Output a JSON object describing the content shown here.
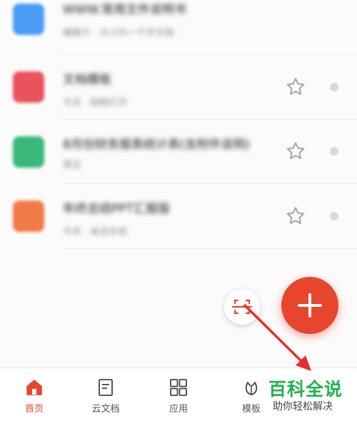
{
  "file_list": {
    "items": [
      {
        "title": "WWW.常用文件说明书",
        "subtitle": "编辑于 · 大小约一千字文档",
        "icon": "document-icon",
        "icon_color": "#4a9cf5",
        "starred": false
      },
      {
        "title": "文档模板",
        "subtitle": "今天 · 刚刚打开",
        "icon": "pdf-icon",
        "icon_color": "#e8535c",
        "starred": false
      },
      {
        "title": "8月份财务报表统计表(含附件说明)",
        "subtitle": "周五",
        "icon": "spreadsheet-icon",
        "icon_color": "#3ab87b",
        "starred": false
      },
      {
        "title": "年终总结PPT汇报版",
        "subtitle": "今天 · 来自手机",
        "icon": "presentation-icon",
        "icon_color": "#f07a48",
        "starred": false
      }
    ]
  },
  "fab": {
    "icon": "plus-icon",
    "color": "#e8452f"
  },
  "scan_button": {
    "icon": "scan-icon"
  },
  "tabbar": {
    "tabs": [
      {
        "label": "首页",
        "icon": "home-icon",
        "active": true
      },
      {
        "label": "云文档",
        "icon": "cloud-doc-icon",
        "active": false
      },
      {
        "label": "应用",
        "icon": "apps-grid-icon",
        "active": false
      },
      {
        "label": "模板",
        "icon": "template-leaf-icon",
        "active": false
      }
    ]
  },
  "watermark": {
    "title": "百科全说",
    "subtitle": "助你轻松解决"
  },
  "colors": {
    "accent": "#e8452f",
    "annotation_arrow": "#e82c2c",
    "watermark_green": "#22b14c"
  }
}
